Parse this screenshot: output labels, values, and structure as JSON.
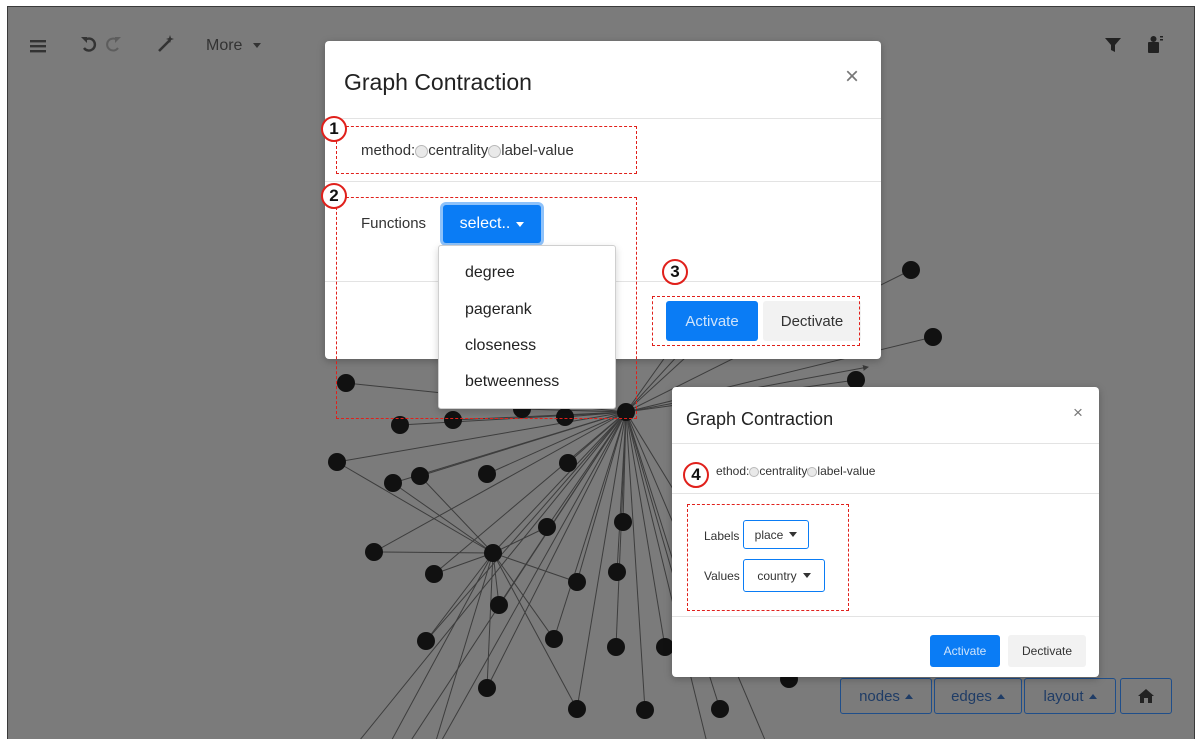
{
  "toolbar": {
    "more_label": "More",
    "icons": [
      "menu-icon",
      "undo-icon",
      "redo-icon",
      "magic-wand-icon",
      "filter-icon",
      "graph-settings-icon"
    ]
  },
  "bottom_toolbar": {
    "nodes_label": "nodes",
    "edges_label": "edges",
    "layout_label": "layout",
    "home_icon": "home-icon"
  },
  "modal_main": {
    "title": "Graph Contraction",
    "method_label": "method:",
    "radio_centrality": "centrality",
    "radio_label_value": "label-value",
    "selected_method": "centrality",
    "functions_label": "Functions",
    "select_label": "select..",
    "options": [
      "degree",
      "pagerank",
      "closeness",
      "betweenness"
    ],
    "activate_label": "Activate",
    "deactivate_label": "Dectivate"
  },
  "modal_small": {
    "title": "Graph Contraction",
    "method_label": "ethod:",
    "radio_centrality": "centrality",
    "radio_label_value": "label-value",
    "selected_method": "label-value",
    "labels_label": "Labels",
    "labels_value": "place",
    "values_label": "Values",
    "values_value": "country",
    "activate_label": "Activate",
    "deactivate_label": "Dectivate"
  },
  "annotations": [
    "1",
    "2",
    "3",
    "4"
  ],
  "colors": {
    "overlay": "#7b7b7b",
    "primary": "#0a7cf5",
    "annotation": "#e0201b",
    "node": "#111111"
  }
}
